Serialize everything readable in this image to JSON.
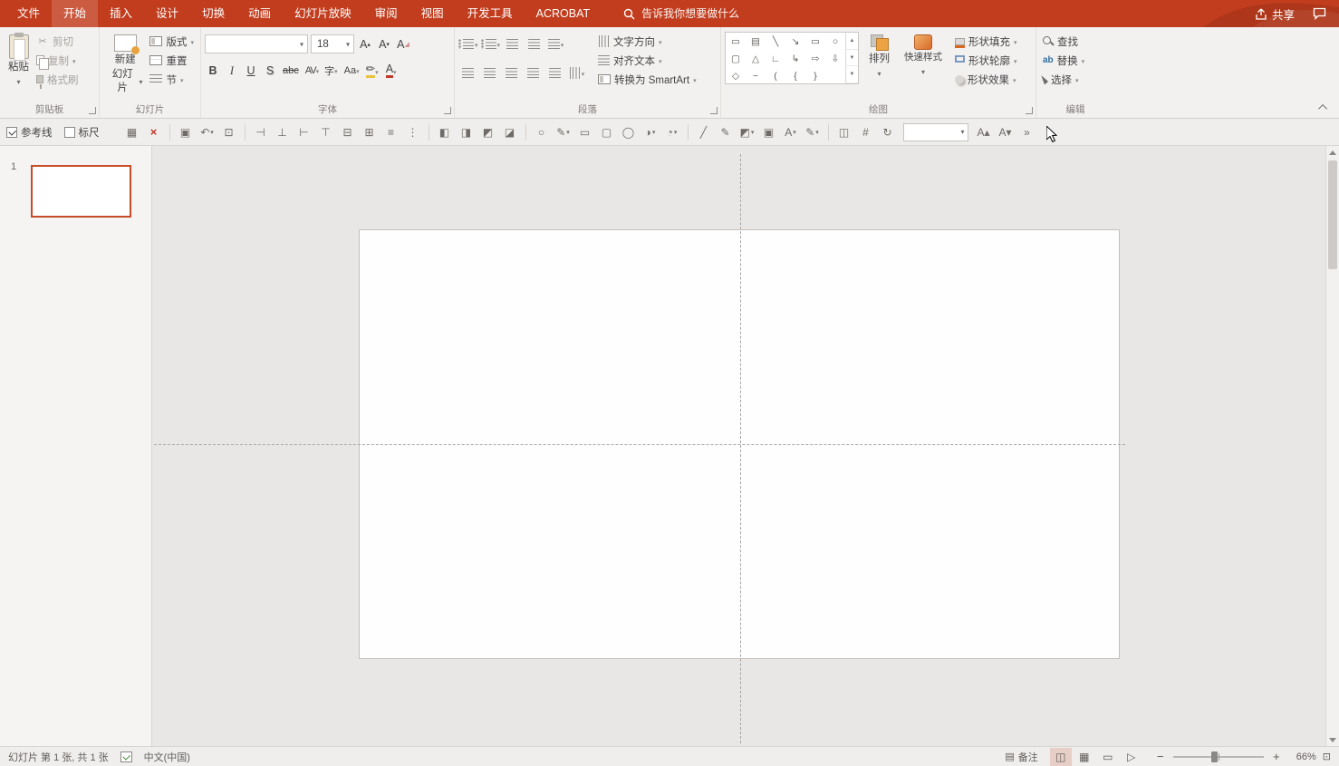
{
  "titlebar": {
    "tabs": [
      {
        "label": "文件",
        "name": "tab-file"
      },
      {
        "label": "开始",
        "name": "tab-home",
        "cls": "sel"
      },
      {
        "label": "插入",
        "name": "tab-insert"
      },
      {
        "label": "设计",
        "name": "tab-design"
      },
      {
        "label": "切换",
        "name": "tab-transitions"
      },
      {
        "label": "动画",
        "name": "tab-animations"
      },
      {
        "label": "幻灯片放映",
        "name": "tab-slideshow"
      },
      {
        "label": "审阅",
        "name": "tab-review"
      },
      {
        "label": "视图",
        "name": "tab-view"
      },
      {
        "label": "开发工具",
        "name": "tab-developer"
      },
      {
        "label": "ACROBAT",
        "name": "tab-acrobat"
      }
    ],
    "search_placeholder": "告诉我你想要做什么",
    "share": "共享"
  },
  "ribbon": {
    "clipboard": {
      "group": "剪贴板",
      "paste": "粘贴",
      "cut": "剪切",
      "copy": "复制",
      "format_painter": "格式刷"
    },
    "slides": {
      "group": "幻灯片",
      "new1": "新建",
      "new2": "幻灯片",
      "layout": "版式",
      "reset": "重置",
      "section": "节"
    },
    "font": {
      "group": "字体",
      "size": "18",
      "bold": "B",
      "italic": "I",
      "underline": "U",
      "shadow": "S",
      "strike": "abc",
      "spacing": "AV",
      "phonetic": "字",
      "case": "Aa",
      "color": "A"
    },
    "paragraph": {
      "group": "段落",
      "text_direction": "文字方向",
      "align_text": "对齐文本",
      "smartart": "转换为 SmartArt"
    },
    "drawing": {
      "group": "绘图",
      "arrange": "排列",
      "quick_styles": "快速样式",
      "fill": "形状填充",
      "outline": "形状轮廓",
      "effects": "形状效果",
      "shapes": [
        "▭",
        "▤",
        "╲",
        "↘",
        "▭",
        "○",
        "▢",
        "△",
        "∟",
        "↳",
        "⇨",
        "⇩",
        "◇",
        "~",
        "(",
        "{",
        "}"
      ],
      "gallery_up": "▲",
      "gallery_down": "▼",
      "gallery_more": "▼"
    },
    "editing": {
      "group": "编辑",
      "find": "查找",
      "replace": "替换",
      "select": "选择",
      "replace_glyph": "ab"
    }
  },
  "toolbar": {
    "guides": "参考线",
    "ruler": "标尺",
    "icons": [
      {
        "name": "table-grid-icon",
        "glyph": "▦"
      },
      {
        "name": "close-icon",
        "glyph": "×",
        "cls": "red"
      },
      {
        "cls": "sep"
      },
      {
        "name": "save-icon",
        "glyph": "▣"
      },
      {
        "name": "undo-icon",
        "glyph": "↶",
        "cls": "drop"
      },
      {
        "name": "start-slideshow-icon",
        "glyph": "⊡"
      },
      {
        "cls": "sep"
      },
      {
        "name": "align-left-objects-icon",
        "glyph": "⊣"
      },
      {
        "name": "align-bottom-objects-icon",
        "glyph": "⊥"
      },
      {
        "name": "align-right-objects-icon",
        "glyph": "⊢"
      },
      {
        "name": "align-top-objects-icon",
        "glyph": "⊤"
      },
      {
        "name": "align-middle-objects-icon",
        "glyph": "⊟"
      },
      {
        "name": "align-center-objects-icon",
        "glyph": "⊞"
      },
      {
        "name": "distribute-horizontal-icon",
        "glyph": "≡"
      },
      {
        "name": "distribute-vertical-icon",
        "glyph": "⋮"
      },
      {
        "cls": "sep"
      },
      {
        "name": "bring-to-front-icon",
        "glyph": "◧"
      },
      {
        "name": "send-to-back-icon",
        "glyph": "◨"
      },
      {
        "name": "bring-forward-icon",
        "glyph": "◩"
      },
      {
        "name": "send-backward-icon",
        "glyph": "◪"
      },
      {
        "cls": "sep"
      },
      {
        "name": "oval-tool-icon",
        "glyph": "○"
      },
      {
        "name": "freeform-tool-icon",
        "glyph": "✎",
        "cls": "drop"
      },
      {
        "name": "rectangle-tool-icon",
        "glyph": "▭"
      },
      {
        "name": "rounded-rectangle-tool-icon",
        "glyph": "▢"
      },
      {
        "name": "ellipse-tool-icon",
        "glyph": "◯"
      },
      {
        "name": "shape-shadow-icon",
        "glyph": "◑",
        "cls": "drop"
      },
      {
        "name": "shape-3d-icon",
        "glyph": "◔",
        "cls": "drop"
      },
      {
        "cls": "sep"
      },
      {
        "name": "eyedropper-icon",
        "glyph": "╱"
      },
      {
        "name": "pen-icon",
        "glyph": "✎"
      },
      {
        "name": "fill-bucket-icon",
        "glyph": "◩",
        "cls": "drop"
      },
      {
        "name": "textbox-icon",
        "glyph": "▣"
      },
      {
        "name": "font-color-icon",
        "glyph": "A",
        "cls": "drop"
      },
      {
        "name": "outline-color-icon",
        "glyph": "✎",
        "cls": "drop"
      },
      {
        "cls": "sep"
      },
      {
        "name": "merge-shapes-icon",
        "glyph": "◫"
      },
      {
        "name": "crop-icon",
        "glyph": "#"
      },
      {
        "name": "rotate-icon",
        "glyph": "↻"
      },
      {
        "name": "style-combo",
        "glyph": "",
        "cls": "combo2"
      },
      {
        "name": "font-increase-icon",
        "glyph": "A▴"
      },
      {
        "name": "font-decrease-icon",
        "glyph": "A▾"
      },
      {
        "name": "more-tools-icon",
        "glyph": "»"
      }
    ]
  },
  "slides_panel": {
    "number": "1"
  },
  "statusbar": {
    "slide_info": "幻灯片 第 1 张, 共 1 张",
    "language": "中文(中国)",
    "notes": "备注",
    "notes_icon": "▤",
    "views": [
      {
        "name": "normal-view-icon",
        "glyph": "◫",
        "cls": "active"
      },
      {
        "name": "slide-sorter-icon",
        "glyph": "▦"
      },
      {
        "name": "reading-view-icon",
        "glyph": "▭"
      },
      {
        "name": "slideshow-view-icon",
        "glyph": "▷"
      }
    ],
    "zoom_out": "−",
    "zoom_in": "+",
    "zoom_value": "66%",
    "fit_icon": "⊡"
  }
}
